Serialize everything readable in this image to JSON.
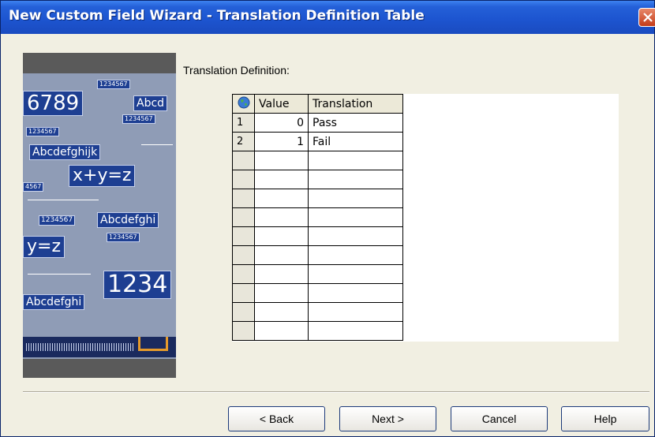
{
  "window": {
    "title": "New Custom Field Wizard - Translation Definition Table"
  },
  "bitmap": {
    "tiles": [
      "1234567",
      "6789",
      "Abcd",
      "1234567",
      "1234567",
      "Abcdefghijk",
      "x+y=z",
      "4567",
      "1234567",
      "Abcdefghi",
      "y=z",
      "1234567",
      "1234",
      "Abcdefghi"
    ]
  },
  "section_label": "Translation Definition:",
  "table": {
    "columns": [
      "Value",
      "Translation"
    ],
    "rows": [
      {
        "num": "1",
        "value": "0",
        "translation": "Pass"
      },
      {
        "num": "2",
        "value": "1",
        "translation": "Fail"
      },
      {
        "num": "",
        "value": "",
        "translation": ""
      },
      {
        "num": "",
        "value": "",
        "translation": ""
      },
      {
        "num": "",
        "value": "",
        "translation": ""
      },
      {
        "num": "",
        "value": "",
        "translation": ""
      },
      {
        "num": "",
        "value": "",
        "translation": ""
      },
      {
        "num": "",
        "value": "",
        "translation": ""
      },
      {
        "num": "",
        "value": "",
        "translation": ""
      },
      {
        "num": "",
        "value": "",
        "translation": ""
      },
      {
        "num": "",
        "value": "",
        "translation": ""
      },
      {
        "num": "",
        "value": "",
        "translation": ""
      }
    ]
  },
  "buttons": {
    "back": "< Back",
    "next": "Next >",
    "cancel": "Cancel",
    "help": "Help"
  },
  "colors": {
    "titlebar": "#2460d8",
    "dialog_bg": "#f1efe2",
    "close": "#c43c1a"
  }
}
